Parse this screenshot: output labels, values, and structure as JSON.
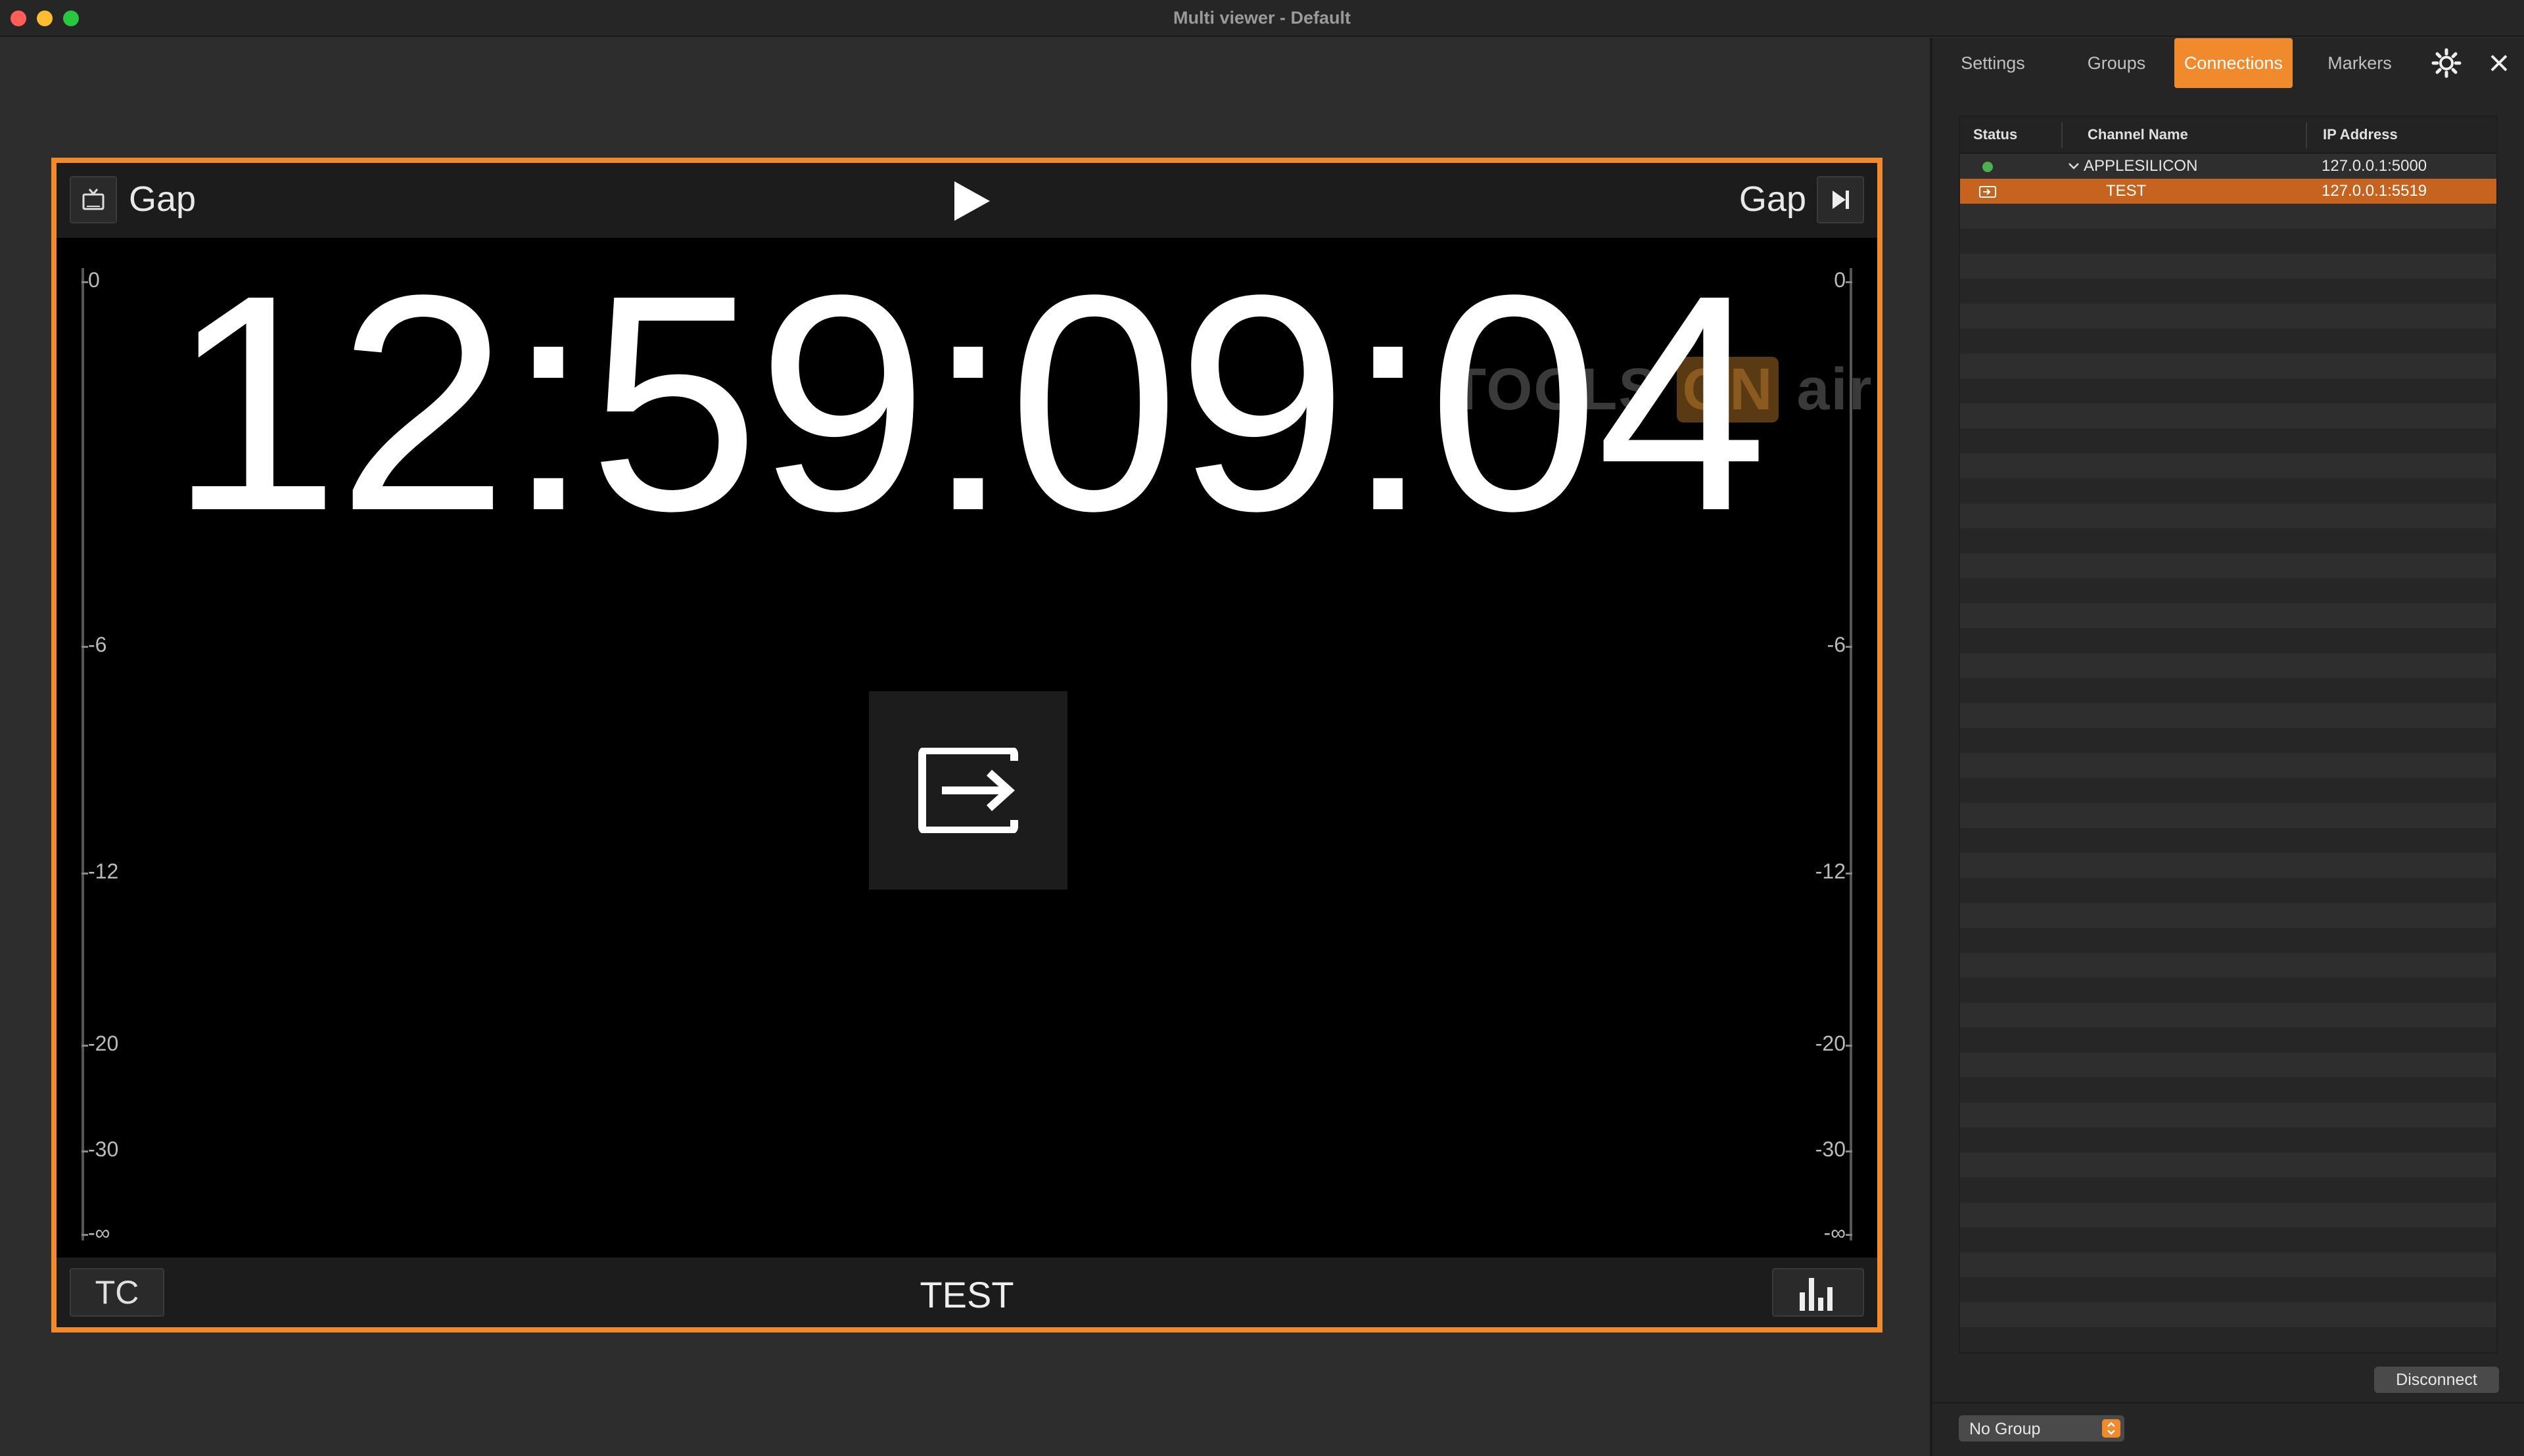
{
  "window": {
    "title": "Multi viewer - Default"
  },
  "viewer": {
    "current_label": "Gap",
    "next_label": "Gap",
    "timecode": "12:59:09:04",
    "watermark": {
      "left": "TOOLS",
      "on": "ON",
      "right": "air"
    },
    "meter_ticks": [
      "0",
      "-6",
      "-12",
      "-20",
      "-30",
      "-∞"
    ],
    "tc_button": "TC",
    "channel_name": "TEST"
  },
  "panel": {
    "tabs": [
      "Settings",
      "Groups",
      "Connections",
      "Markers"
    ],
    "active_tab": "Connections",
    "table": {
      "headers": [
        "Status",
        "Channel Name",
        "IP Address"
      ],
      "rows": [
        {
          "status": "connected",
          "name": "APPLESILICON",
          "ip": "127.0.0.1:5000",
          "expanded": true
        },
        {
          "status": "output",
          "name": "TEST",
          "ip": "127.0.0.1:5519",
          "selected": true
        }
      ]
    },
    "disconnect_label": "Disconnect",
    "group_select": "No Group"
  },
  "colors": {
    "accent": "#f08a2d",
    "status_connected": "#4caf50"
  }
}
